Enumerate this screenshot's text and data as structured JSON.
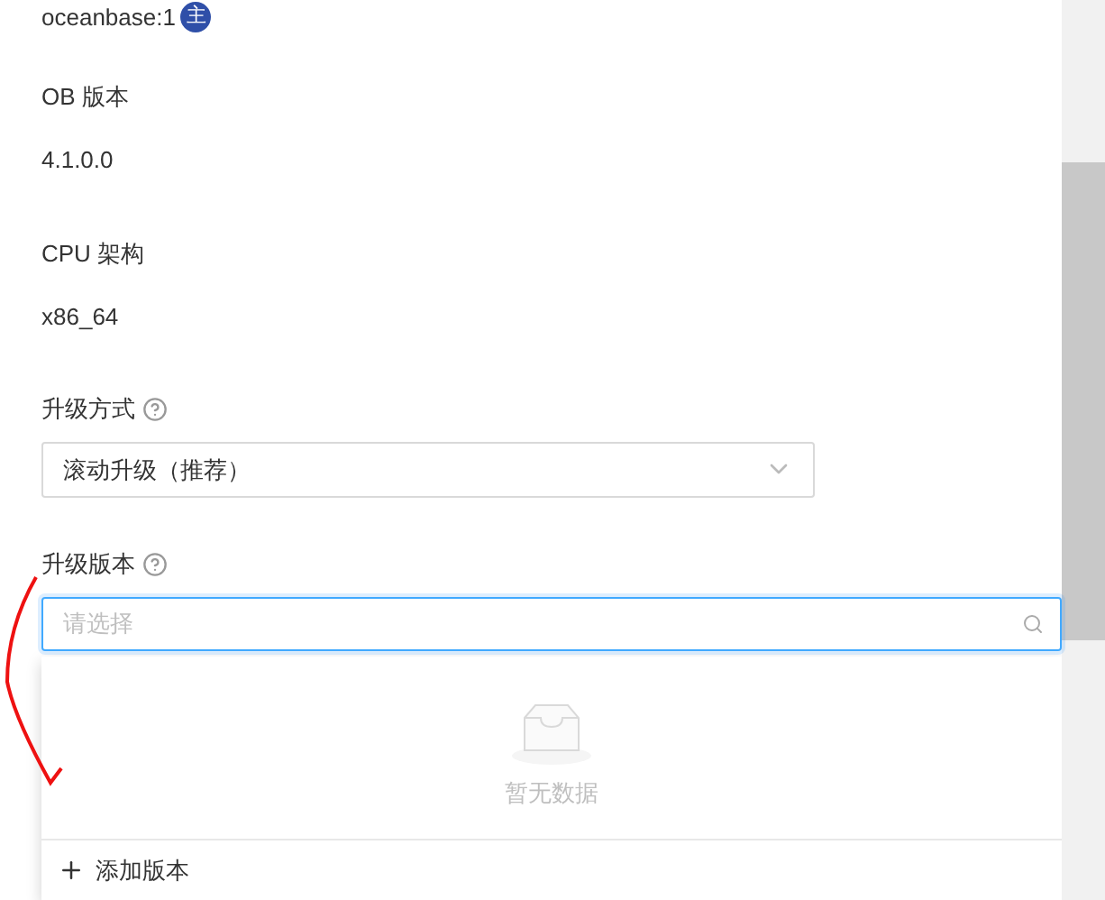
{
  "host": {
    "name": "oceanbase:1",
    "badge": "主"
  },
  "info": [
    {
      "label": "OB 版本",
      "value": "4.1.0.0"
    },
    {
      "label": "CPU 架构",
      "value": "x86_64"
    }
  ],
  "upgrade_method": {
    "label": "升级方式",
    "value": "滚动升级（推荐）"
  },
  "upgrade_version": {
    "label": "升级版本",
    "placeholder": "请选择",
    "empty_text": "暂无数据",
    "add_label": "添加版本"
  }
}
